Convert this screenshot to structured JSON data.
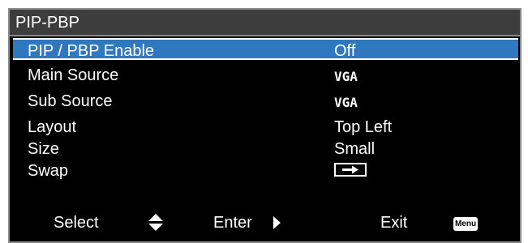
{
  "menu": {
    "title": "PIP-PBP",
    "items": [
      {
        "label": "PIP / PBP Enable",
        "value": "Off",
        "selected": true
      },
      {
        "label": "Main Source",
        "value": "VGA"
      },
      {
        "label": "Sub Source",
        "value": "VGA"
      },
      {
        "label": "Layout",
        "value": "Top Left"
      },
      {
        "label": "Size",
        "value": "Small"
      },
      {
        "label": "Swap",
        "value_icon": "swap-arrow-icon"
      }
    ]
  },
  "footer": {
    "select_label": "Select",
    "select_icon": "up-down-arrow-icon",
    "enter_label": "Enter",
    "enter_icon": "right-triangle-icon",
    "exit_label": "Exit",
    "menu_key_label": "Menu"
  },
  "colors": {
    "background": "#000000",
    "title_bar": "#3d3d3d",
    "highlight": "#2f78bf",
    "border": "#8a8a8a",
    "text": "#ffffff"
  }
}
